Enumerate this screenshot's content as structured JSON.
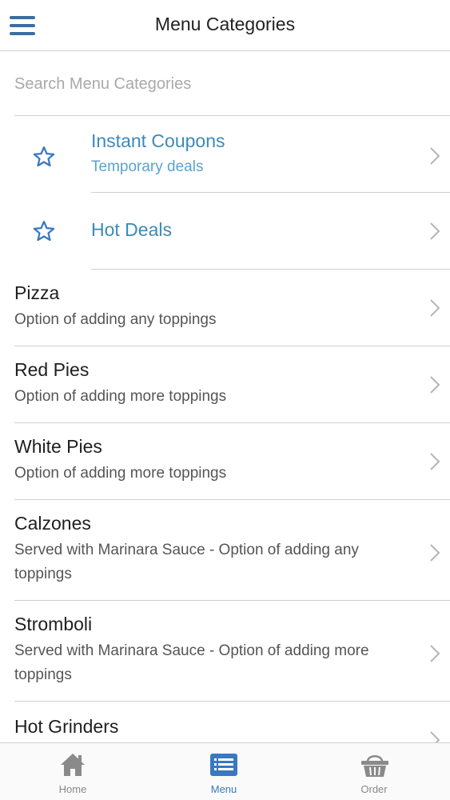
{
  "header": {
    "title": "Menu Categories"
  },
  "search": {
    "placeholder": "Search Menu Categories"
  },
  "favorites": [
    {
      "title": "Instant Coupons",
      "desc": "Temporary deals"
    },
    {
      "title": "Hot Deals",
      "desc": ""
    }
  ],
  "categories": [
    {
      "title": "Pizza",
      "desc": "Option of adding any toppings"
    },
    {
      "title": "Red Pies",
      "desc": "Option of adding more toppings"
    },
    {
      "title": "White Pies",
      "desc": "Option of adding more toppings"
    },
    {
      "title": "Calzones",
      "desc": "Served with Marinara Sauce - Option of adding any toppings"
    },
    {
      "title": "Stromboli",
      "desc": "Served with Marinara Sauce - Option of adding more toppings"
    },
    {
      "title": "Hot Grinders",
      "desc": ""
    }
  ],
  "tabs": [
    {
      "label": "Home",
      "icon": "home-icon"
    },
    {
      "label": "Menu",
      "icon": "menu-list-icon"
    },
    {
      "label": "Order",
      "icon": "basket-icon"
    }
  ],
  "colors": {
    "accent": "#3a78c2",
    "favorite_title": "#3c8ab8",
    "favorite_desc": "#5aa3cc"
  }
}
